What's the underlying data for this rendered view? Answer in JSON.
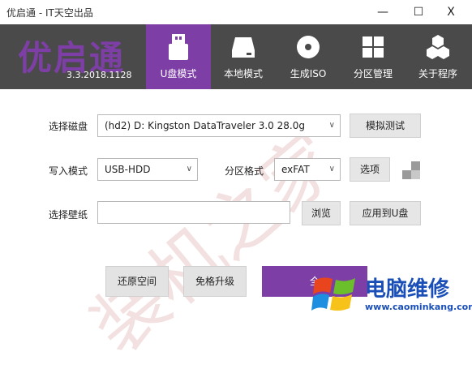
{
  "window": {
    "title": "优启通 - IT天空出品",
    "minimize": "—",
    "maximize": "☐",
    "close": "X"
  },
  "header": {
    "logo": "优启通",
    "version": "3.3.2018.1128",
    "tabs": [
      {
        "label": "U盘模式",
        "icon": "usb-icon",
        "active": true
      },
      {
        "label": "本地模式",
        "icon": "hdd-icon",
        "active": false
      },
      {
        "label": "生成ISO",
        "icon": "disc-icon",
        "active": false
      },
      {
        "label": "分区管理",
        "icon": "partition-icon",
        "active": false
      },
      {
        "label": "关于程序",
        "icon": "about-icon",
        "active": false
      }
    ]
  },
  "form": {
    "disk_label": "选择磁盘",
    "disk_value": "(hd2) D: Kingston DataTraveler 3.0 28.0g",
    "simulate_label": "模拟测试",
    "write_label": "写入模式",
    "write_value": "USB-HDD",
    "partition_label": "分区格式",
    "partition_value": "exFAT",
    "options_label": "选项",
    "wallpaper_label": "选择壁纸",
    "wallpaper_value": "",
    "browse_label": "浏览",
    "apply_label": "应用到U盘"
  },
  "actions": {
    "restore_label": "还原空间",
    "upgrade_label": "免格升级",
    "primary_label": "全"
  },
  "overlay": {
    "watermark": "装机之家",
    "brand": "电脑维修",
    "url": "www.caominkang.com"
  },
  "colors": {
    "accent": "#7d3fa6",
    "header_bg": "#4a4a4a",
    "brand_blue": "#1a4fb8"
  }
}
